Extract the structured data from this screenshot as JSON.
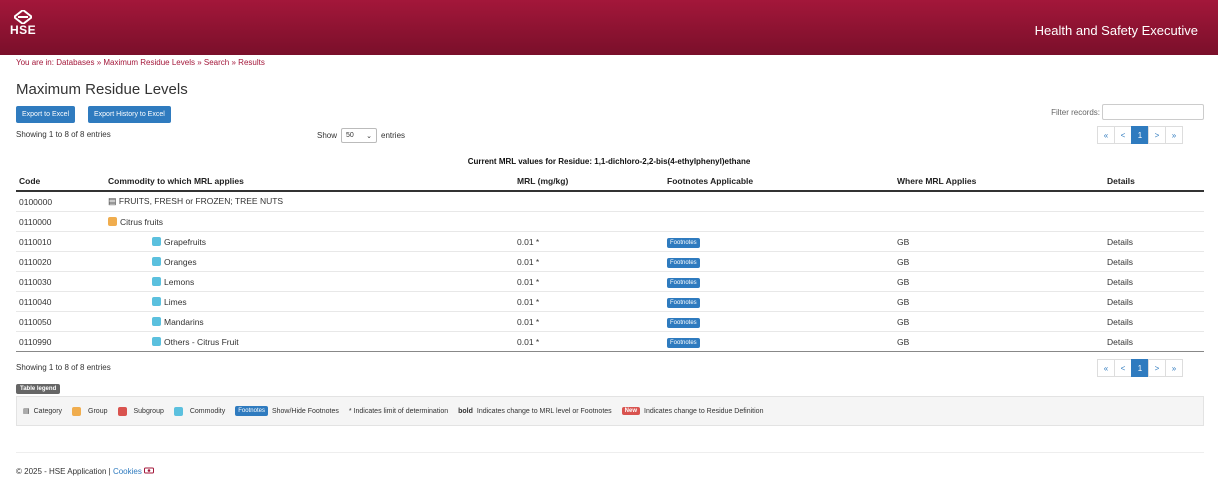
{
  "header": {
    "logo_text": "HSE",
    "site_title": "Health and Safety Executive"
  },
  "breadcrumb": {
    "prefix": "You are in:",
    "items": [
      "Databases",
      "Maximum Residue Levels",
      "Search",
      "Results"
    ],
    "separator": "»"
  },
  "page_title": "Maximum Residue Levels",
  "buttons": {
    "export_excel": "Export to Excel",
    "export_history": "Export History to Excel"
  },
  "filter": {
    "label": "Filter records:",
    "value": ""
  },
  "entries": {
    "top_info": "Showing 1 to 8 of 8 entries",
    "bottom_info": "Showing 1 to 8 of 8 entries",
    "show_label": "Show",
    "show_value": "50",
    "entries_label": "entries"
  },
  "pagination": {
    "first": "«",
    "prev": "<",
    "current": "1",
    "next": ">",
    "last": "»"
  },
  "caption": "Current MRL values for Residue: 1,1-dichloro-2,2-bis(4-ethylphenyl)ethane",
  "table": {
    "headers": [
      "Code",
      "Commodity to which MRL applies",
      "MRL (mg/kg)",
      "Footnotes Applicable",
      "Where MRL Applies",
      "Details"
    ],
    "rows": [
      {
        "code": "0100000",
        "commodity": "FRUITS, FRESH or FROZEN; TREE NUTS",
        "mrl": "",
        "footnotes": "",
        "where": "",
        "details": ""
      },
      {
        "code": "0110000",
        "commodity": "Citrus fruits",
        "mrl": "",
        "footnotes": "",
        "where": "",
        "details": ""
      },
      {
        "code": "0110010",
        "commodity": "Grapefruits",
        "mrl": "0.01 *",
        "footnotes": "Footnotes",
        "where": "GB",
        "details": "Details"
      },
      {
        "code": "0110020",
        "commodity": "Oranges",
        "mrl": "0.01 *",
        "footnotes": "Footnotes",
        "where": "GB",
        "details": "Details"
      },
      {
        "code": "0110030",
        "commodity": "Lemons",
        "mrl": "0.01 *",
        "footnotes": "Footnotes",
        "where": "GB",
        "details": "Details"
      },
      {
        "code": "0110040",
        "commodity": "Limes",
        "mrl": "0.01 *",
        "footnotes": "Footnotes",
        "where": "GB",
        "details": "Details"
      },
      {
        "code": "0110050",
        "commodity": "Mandarins",
        "mrl": "0.01 *",
        "footnotes": "Footnotes",
        "where": "GB",
        "details": "Details"
      },
      {
        "code": "0110990",
        "commodity": "Others - Citrus Fruit",
        "mrl": "0.01 *",
        "footnotes": "Footnotes",
        "where": "GB",
        "details": "Details"
      }
    ]
  },
  "legend": {
    "tag": "Table legend",
    "category": "Category",
    "group": "Group",
    "subgroup": "Subgroup",
    "commodity": "Commodity",
    "footnotes_badge": "Footnotes",
    "footnotes_text": "Show/Hide Footnotes",
    "lod_text": "* Indicates limit of determination",
    "bold_word": "bold",
    "bold_text": "Indicates change to MRL level or Footnotes",
    "new_badge": "New",
    "new_text": "Indicates change to Residue Definition"
  },
  "footer": {
    "text": "© 2025 - HSE Application |",
    "cookies": "Cookies"
  },
  "colors": {
    "header": "#a3173a",
    "group": "#f0ad4e",
    "subgroup": "#d9534f",
    "commodity": "#5bc0de",
    "primary": "#2f7bbf"
  }
}
